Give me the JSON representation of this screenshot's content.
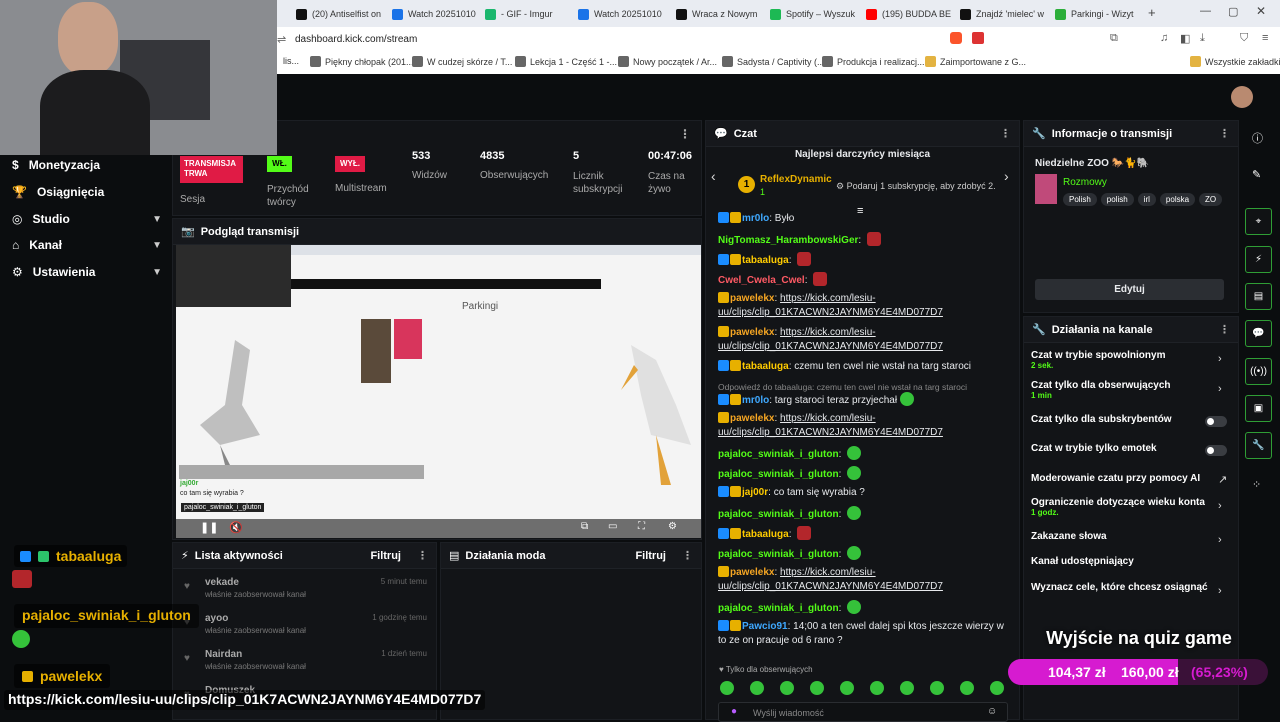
{
  "browser": {
    "tabs": [
      {
        "label": "(20) Antiselfist on",
        "color": "#111"
      },
      {
        "label": "Watch 20251010",
        "color": "#1a73e8"
      },
      {
        "label": "- GIF - Imgur",
        "color": "#1bb76e"
      },
      {
        "label": "Watch 20251010",
        "color": "#1a73e8"
      },
      {
        "label": "Wraca z Nowym",
        "color": "#111"
      },
      {
        "label": "Spotify – Wyszuk",
        "color": "#1db954"
      },
      {
        "label": "(195) BUDDA BE",
        "color": "#ff0000"
      },
      {
        "label": "Znajdź 'mielec' w",
        "color": "#111"
      },
      {
        "label": "Parkingi - Wizyt",
        "color": "#2cae3a"
      }
    ],
    "url": "dashboard.kick.com/stream",
    "bookmarks": [
      "lis...",
      "Piękny chłopak (201...",
      "W cudzej skórze / T...",
      "Lekcja 1 - Część 1 -...",
      "Nowy początek / Ar...",
      "Sadysta / Captivity (...",
      "Produkcja i realizacj...",
      "Zaimportowane z G...",
      "Wszystkie zakładki"
    ]
  },
  "sidebar": {
    "items": [
      {
        "label": "Monetyzacja"
      },
      {
        "label": "Osiągnięcia"
      },
      {
        "label": "Studio"
      },
      {
        "label": "Kanał"
      },
      {
        "label": "Ustawienia"
      }
    ]
  },
  "session": {
    "live_badge": "TRANSMISJA TRWA",
    "session_label": "Sesja",
    "revenue_badge": "WŁ.",
    "revenue_label": "Przychód twórcy",
    "multistream_badge": "WYŁ.",
    "multistream_label": "Multistream",
    "viewers_num": "533",
    "viewers_label": "Widzów",
    "followers_num": "4835",
    "followers_label": "Obserwujących",
    "subs_num": "5",
    "subs_label": "Licznik subskrypcji",
    "time_num": "00:47:06",
    "time_label": "Czas na żywo"
  },
  "preview": {
    "title": "Podgląd transmisji",
    "page_heading": "Parkingi",
    "preview_chat_user": "jaj00r",
    "preview_chat_msg": "co tam się wyrabia ?",
    "preview_user_tag": "pajaloc_swiniak_i_gluton"
  },
  "activity": {
    "title": "Lista aktywności",
    "filter": "Filtruj",
    "rows": [
      {
        "who": "vekade",
        "what": "właśnie zaobserwował kanał",
        "when": "5 minut temu"
      },
      {
        "who": "ayoo",
        "what": "właśnie zaobserwował kanał",
        "when": "1 godzinę temu"
      },
      {
        "who": "Nairdan",
        "what": "właśnie zaobserwował kanał",
        "when": "1 dzień temu"
      },
      {
        "who": "Domuszek",
        "what": "",
        "when": ""
      }
    ]
  },
  "mod": {
    "title": "Działania moda",
    "filter": "Filtruj"
  },
  "chat": {
    "title": "Czat",
    "top_title": "Najlepsi darczyńcy miesiąca",
    "top_rank": "1",
    "top_user": "ReflexDynamic",
    "top_count": "1",
    "gift_cta": "Podaruj 1 subskrypcję, aby zdobyć 2.",
    "messages": [
      {
        "user": "mr0lo",
        "text": "Było",
        "cls": "ub"
      },
      {
        "user": "NigTomasz_HarambowskiGer",
        "text": "",
        "cls": "ug",
        "emote": "red"
      },
      {
        "user": "tabaaluga",
        "text": "",
        "cls": "uy",
        "emote": "red"
      },
      {
        "user": "Cwel_Cwela_Cwel",
        "text": "",
        "cls": "ur",
        "emote": "red"
      },
      {
        "user": "pawelekx",
        "text": "https://kick.com/lesiu-uu/clips/clip_01K7ACWN2JAYNM6Y4E4MD077D7",
        "cls": "uo",
        "link": true
      },
      {
        "user": "pawelekx",
        "text": "https://kick.com/lesiu-uu/clips/clip_01K7ACWN2JAYNM6Y4E4MD077D7",
        "cls": "uo",
        "link": true
      },
      {
        "user": "tabaaluga",
        "text": "czemu ten cwel nie wstał na targ staroci",
        "cls": "uy"
      },
      {
        "reply": "Odpowiedź do tabaaluga: czemu ten cwel nie wstał na targ staroci",
        "user": "mr0lo",
        "text": "targ staroci teraz przyjechał",
        "cls": "ub",
        "emote": "green"
      },
      {
        "user": "pawelekx",
        "text": "https://kick.com/lesiu-uu/clips/clip_01K7ACWN2JAYNM6Y4E4MD077D7",
        "cls": "uo",
        "link": true
      },
      {
        "user": "pajaloc_swiniak_i_gluton",
        "text": "",
        "cls": "ug",
        "emote": "green"
      },
      {
        "user": "pajaloc_swiniak_i_gluton",
        "text": "",
        "cls": "ug",
        "emote": "green"
      },
      {
        "user": "jaj00r",
        "text": "co tam się wyrabia ?",
        "cls": "uy"
      },
      {
        "user": "pajaloc_swiniak_i_gluton",
        "text": "",
        "cls": "ug",
        "emote": "green"
      },
      {
        "user": "tabaaluga",
        "text": "",
        "cls": "uy",
        "emote": "red"
      },
      {
        "user": "pajaloc_swiniak_i_gluton",
        "text": "",
        "cls": "ug",
        "emote": "green"
      },
      {
        "user": "pawelekx",
        "text": "https://kick.com/lesiu-uu/clips/clip_01K7ACWN2JAYNM6Y4E4MD077D7",
        "cls": "uo",
        "link": true
      },
      {
        "user": "pajaloc_swiniak_i_gluton",
        "text": "",
        "cls": "ug",
        "emote": "green"
      },
      {
        "user": "Pawcio91",
        "text": "14;00 a ten cwel dalej spi ktos jeszcze wierzy w to ze on pracuje od 6 rano ?",
        "cls": "ub"
      }
    ],
    "followers_only": "Tylko dla obserwujących",
    "input_placeholder": "Wyślij wiadomość"
  },
  "info": {
    "title": "Informacje o transmisji",
    "stream_title": "Niedzielne ZOO 🐎🐈🐘",
    "category": "Rozmowy",
    "tags": [
      "Polish",
      "polish",
      "irl",
      "polska",
      "ZO"
    ],
    "edit": "Edytuj"
  },
  "channel_actions": {
    "title": "Działania na kanale",
    "items": [
      {
        "label": "Czat w trybie spowolnionym",
        "sub": "2 sek.",
        "type": "arrow"
      },
      {
        "label": "Czat tylko dla obserwujących",
        "sub": "1 min",
        "type": "arrow"
      },
      {
        "label": "Czat tylko dla subskrybentów",
        "sub": "",
        "type": "toggle"
      },
      {
        "label": "Czat w trybie tylko emotek",
        "sub": "",
        "type": "toggle"
      },
      {
        "label": "Moderowanie czatu przy pomocy AI",
        "sub": "",
        "type": "ext"
      },
      {
        "label": "Ograniczenie dotyczące wieku konta",
        "sub": "1 godz.",
        "type": "arrow"
      },
      {
        "label": "Zakazane słowa",
        "sub": "",
        "type": "arrow"
      },
      {
        "label": "Kanał udostępniający",
        "sub": "",
        "type": "none"
      },
      {
        "label": "Wyznacz cele, które chcesz osiągnąć",
        "sub": "",
        "type": "arrow"
      }
    ]
  },
  "overlay": {
    "quiz": "Wyjście na quiz game",
    "goal_current": "104,37 zł",
    "goal_target": "160,00 zł",
    "goal_pct": "65,23%",
    "goal_fraction": 0.6523,
    "name1": "tabaaluga",
    "name2": "pajaloc_swiniak_i_gluton",
    "name3": "pawelekx",
    "clip_url": "https://kick.com/lesiu-uu/clips/clip_01K7ACWN2JAYNM6Y4E4MD077D7"
  },
  "colors": {
    "kick_green": "#53fc18",
    "live_red": "#e01b45",
    "goal_pink": "#d61bd0"
  }
}
